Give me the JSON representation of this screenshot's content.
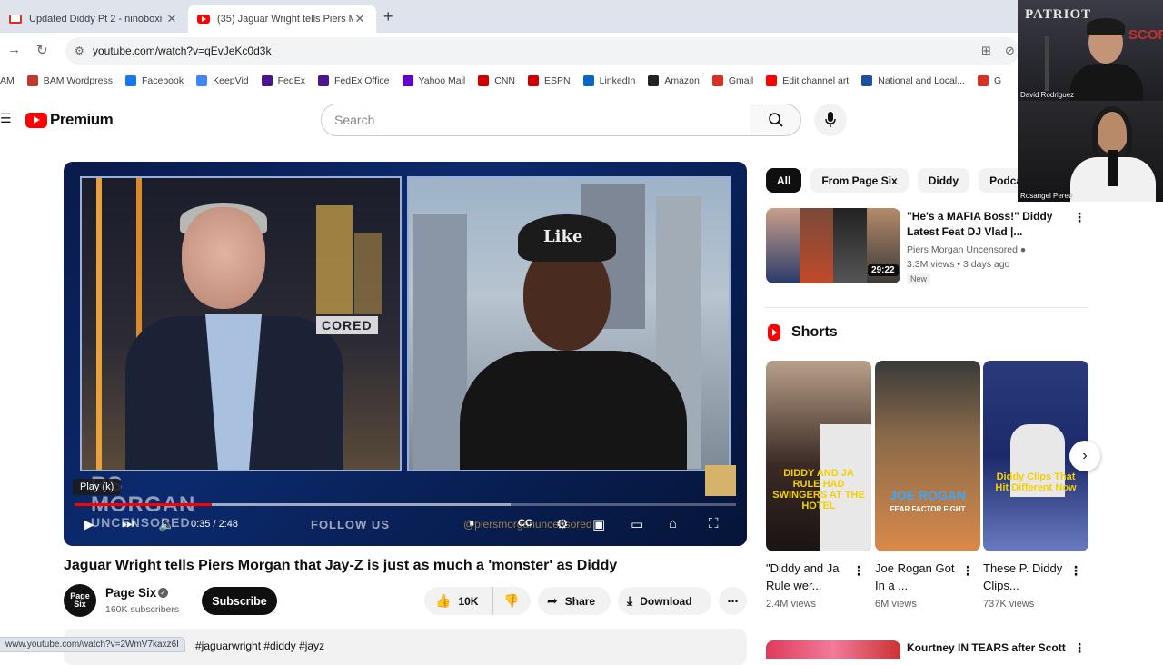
{
  "browser": {
    "tabs": [
      {
        "title": "Updated Diddy Pt 2 - ninoboxi",
        "favicon": "gmail-icon",
        "active": false
      },
      {
        "title": "(35) Jaguar Wright tells Piers M",
        "favicon": "youtube-icon",
        "active": true
      }
    ],
    "new_tab": "+",
    "close": "✕",
    "url": "youtube.com/watch?v=qEvJeKc0d3k",
    "bookmarks": [
      {
        "label": "AM",
        "color": "#ffffff"
      },
      {
        "label": "BAM Wordpress",
        "color": "#c0392b"
      },
      {
        "label": "Facebook",
        "color": "#1877f2"
      },
      {
        "label": "KeepVid",
        "color": "#4285f4"
      },
      {
        "label": "FedEx",
        "color": "#4d148c"
      },
      {
        "label": "FedEx Office",
        "color": "#4d148c"
      },
      {
        "label": "Yahoo Mail",
        "color": "#6001d2"
      },
      {
        "label": "CNN",
        "color": "#cc0000"
      },
      {
        "label": "ESPN",
        "color": "#d00000"
      },
      {
        "label": "LinkedIn",
        "color": "#0a66c2"
      },
      {
        "label": "Amazon",
        "color": "#222222"
      },
      {
        "label": "Gmail",
        "color": "#d93025"
      },
      {
        "label": "Edit channel art",
        "color": "#ff0000"
      },
      {
        "label": "National and Local...",
        "color": "#1f4e9c"
      },
      {
        "label": "G",
        "color": "#d93025"
      }
    ]
  },
  "youtube": {
    "logo": "Premium",
    "search_placeholder": "Search"
  },
  "player": {
    "tooltip": "Play (k)",
    "lower_third": [
      "RS",
      "MORGAN",
      "UNCENSORED"
    ],
    "overlay_badge": "CORED",
    "cap_text": "Like",
    "follow_text": "FOLLOW US",
    "handle_text": "@piersmorganuncensored",
    "time_current": "0:35",
    "time_total": "2:48",
    "progress": 0.208,
    "buffered": 0.66
  },
  "video": {
    "title": "Jaguar Wright tells Piers Morgan that Jay-Z is just as much a 'monster' as Diddy",
    "channel": "Page Six",
    "avatar_text": "Page Six",
    "subscribers": "160K subscribers",
    "subscribe_label": "Subscribe",
    "likes": "10K",
    "share_label": "Share",
    "download_label": "Download",
    "hashtags": "#jaguarwright #diddy #jayz",
    "status_url": "www.youtube.com/watch?v=2WmV7kaxz6I"
  },
  "sidebar": {
    "chips": [
      "All",
      "From Page Six",
      "Diddy",
      "Podcasts"
    ],
    "rec": {
      "title": "\"He's a MAFIA Boss!\" Diddy Latest Feat DJ Vlad |...",
      "channel": "Piers Morgan Uncensored",
      "meta": "3.3M views • 3 days ago",
      "badge": "New",
      "duration": "29:22"
    },
    "shorts_heading": "Shorts",
    "shorts": [
      {
        "title": "\"Diddy and Ja Rule wer...",
        "views": "2.4M views",
        "caption": "DIDDY AND JA RULE HAD SWINGERS AT THE HOTEL",
        "caption_color": "#f5d000",
        "bg": "#2a2321"
      },
      {
        "title": "Joe Rogan Got In a ...",
        "views": "6M views",
        "caption": "JOE ROGAN",
        "sub_caption": "FEAR FACTOR FIGHT",
        "caption_color": "#3aa7ff",
        "bg": "#8a6a4a"
      },
      {
        "title": "These P. Diddy Clips...",
        "views": "737K views",
        "caption": "Diddy Clips That Hit Different Now",
        "caption_color": "#f5d000",
        "bg": "#1c2a6b"
      }
    ],
    "rec2_title": "Kourtney IN TEARS after Scott"
  },
  "webcam": {
    "top_name": "David Rodriguez",
    "bottom_name": "Rosangel Perez",
    "sign_left": "PATRIOT",
    "sign_right": "SCORN"
  },
  "colors": {
    "youtube_red": "#ff0000",
    "accent_black": "#0f0f0f",
    "chip_bg": "#f2f2f2"
  }
}
